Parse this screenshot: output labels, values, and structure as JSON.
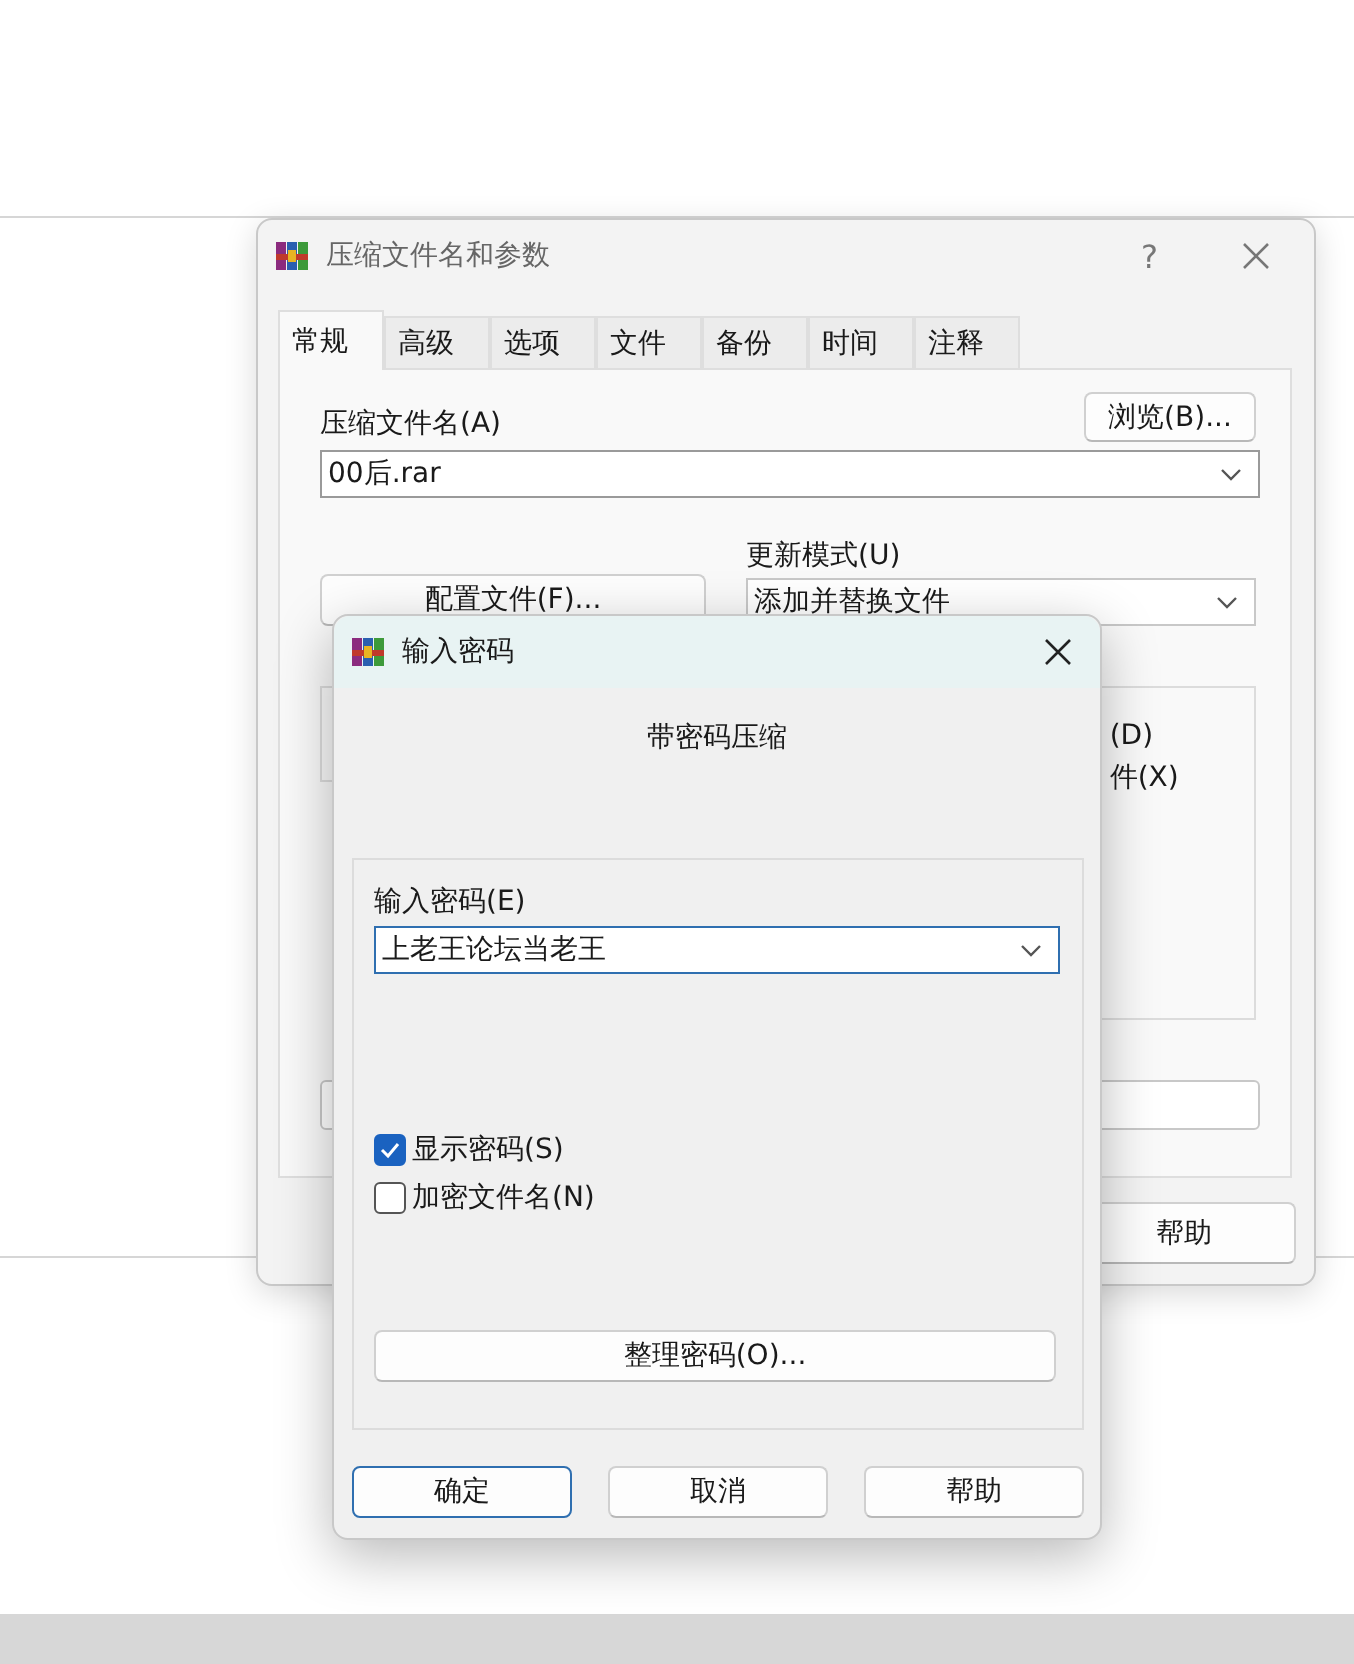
{
  "archive_window": {
    "title": "压缩文件名和参数",
    "help_glyph": "?",
    "tabs": [
      {
        "label": "常规",
        "selected": true
      },
      {
        "label": "高级",
        "selected": false
      },
      {
        "label": "选项",
        "selected": false
      },
      {
        "label": "文件",
        "selected": false
      },
      {
        "label": "备份",
        "selected": false
      },
      {
        "label": "时间",
        "selected": false
      },
      {
        "label": "注释",
        "selected": false
      }
    ],
    "archive_name_label": "压缩文件名(A)",
    "browse_button": "浏览(B)...",
    "archive_name_value": "00后.rar",
    "profiles_button": "配置文件(F)...",
    "update_mode_label": "更新模式(U)",
    "update_mode_value": "添加并替换文件",
    "partial_options": [
      "(D)",
      "件(X)"
    ],
    "help_button": "帮助"
  },
  "password_dialog": {
    "title": "输入密码",
    "heading": "带密码压缩",
    "password_label": "输入密码(E)",
    "password_value": "上老王论坛当老王",
    "checkboxes": [
      {
        "label": "显示密码(S)",
        "checked": true
      },
      {
        "label": "加密文件名(N)",
        "checked": false
      }
    ],
    "organize_button": "整理密码(O)...",
    "buttons": [
      {
        "label": "确定",
        "default": true
      },
      {
        "label": "取消",
        "default": false
      },
      {
        "label": "帮助",
        "default": false
      }
    ]
  }
}
